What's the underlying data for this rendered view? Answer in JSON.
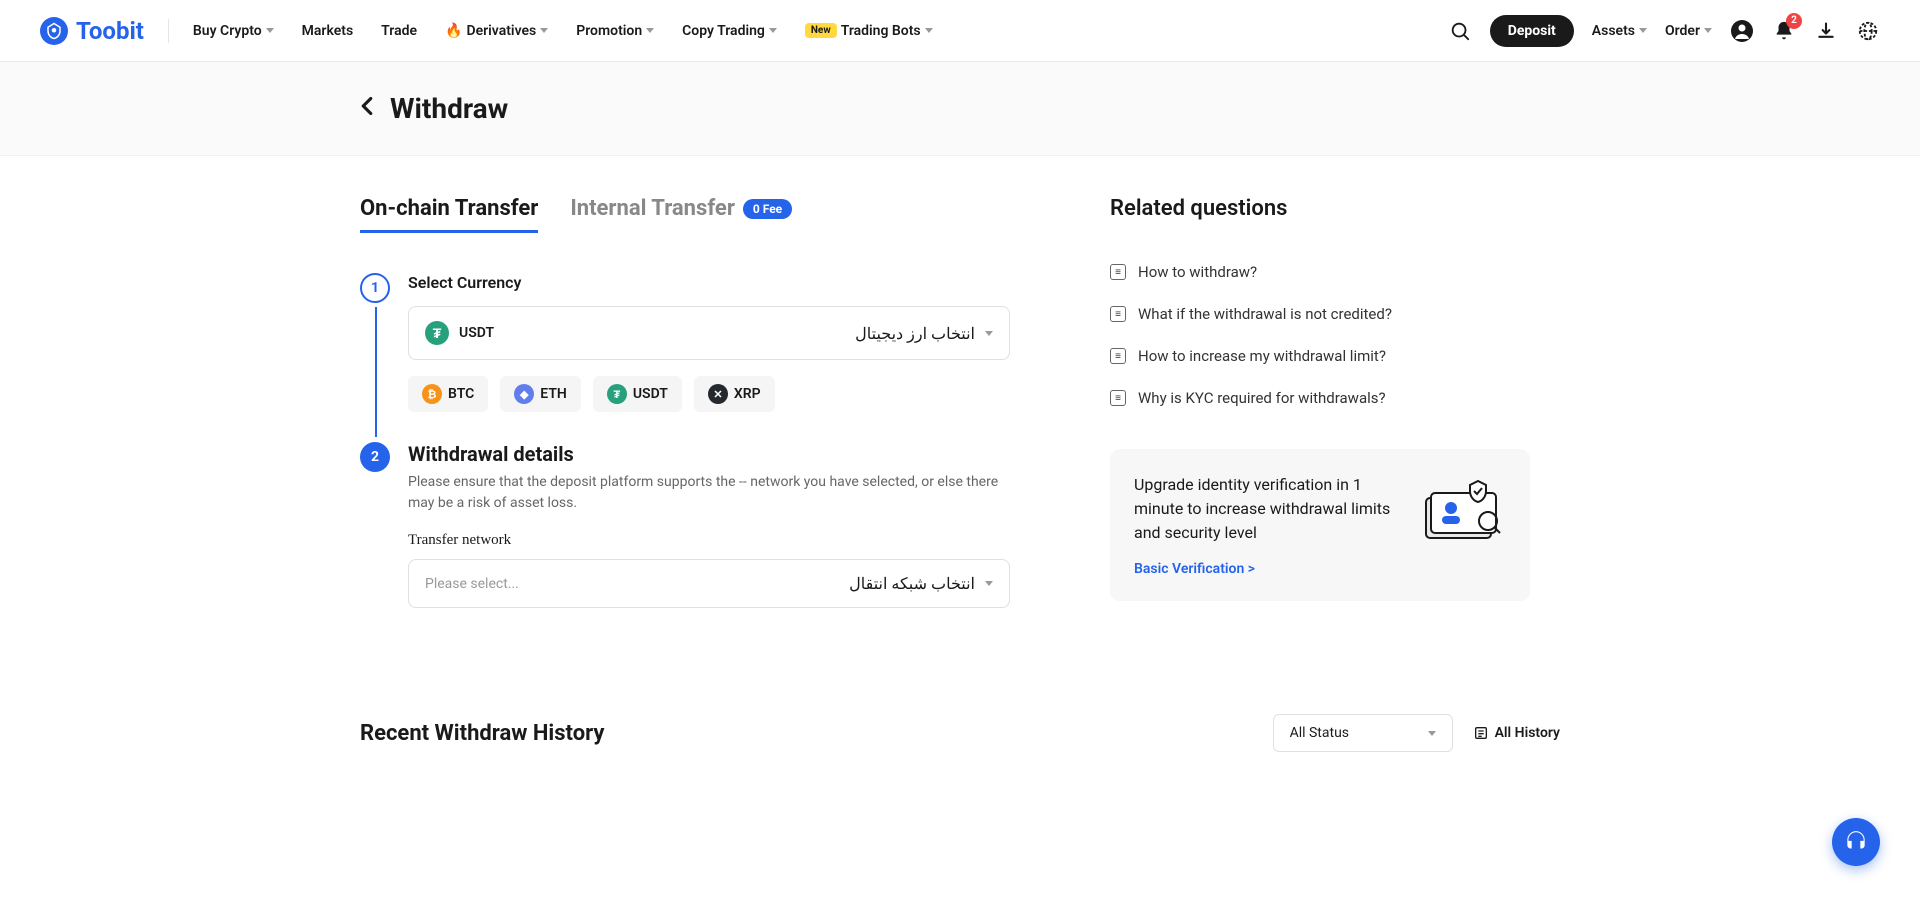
{
  "header": {
    "logo": "Toobit",
    "nav": {
      "buyCrypto": "Buy Crypto",
      "markets": "Markets",
      "trade": "Trade",
      "derivatives": "Derivatives",
      "promotion": "Promotion",
      "copyTrading": "Copy Trading",
      "tradingBots": "Trading Bots",
      "newBadge": "New"
    },
    "deposit": "Deposit",
    "assets": "Assets",
    "order": "Order",
    "notifCount": "2"
  },
  "page": {
    "title": "Withdraw"
  },
  "tabs": {
    "onchain": "On-chain Transfer",
    "internal": "Internal Transfer",
    "feeBadge": "0 Fee"
  },
  "step1": {
    "num": "1",
    "label": "Select Currency",
    "selectedCoin": "USDT",
    "hint": "انتخاب ارز دیجیتال",
    "quickCoins": {
      "btc": "BTC",
      "eth": "ETH",
      "usdt": "USDT",
      "xrp": "XRP"
    }
  },
  "step2": {
    "num": "2",
    "title": "Withdrawal details",
    "desc": "Please ensure that the deposit platform supports the -- network you have selected, or else there may be a risk of asset loss.",
    "networkLabel": "Transfer network",
    "networkPlaceholder": "Please select...",
    "networkHint": "انتخاب شبکه انتقال"
  },
  "sidebar": {
    "title": "Related questions",
    "faq": [
      "How to withdraw?",
      "What if the withdrawal is not credited?",
      "How to increase my withdrawal limit?",
      "Why is KYC required for withdrawals?"
    ],
    "upgradeMsg": "Upgrade identity verification in 1 minute to increase withdrawal limits and security level",
    "upgradeLink": "Basic Verification >"
  },
  "history": {
    "title": "Recent Withdraw History",
    "statusFilter": "All Status",
    "allHistory": "All History"
  }
}
